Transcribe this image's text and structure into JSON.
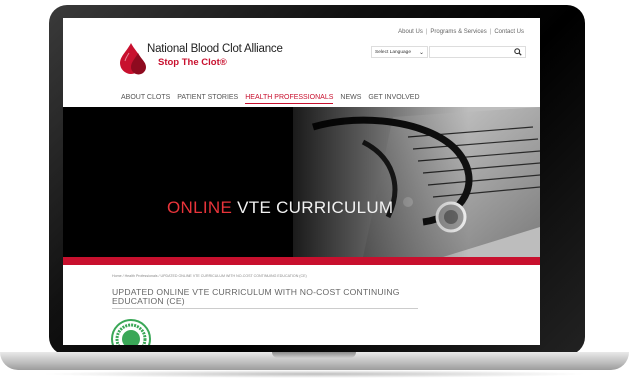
{
  "header": {
    "top_links": [
      "About Us",
      "Programs & Services",
      "Contact Us"
    ],
    "logo_name": "National Blood Clot Alliance",
    "logo_tagline": "Stop The Clot®",
    "language_select": "Select Language",
    "search_placeholder": ""
  },
  "nav": {
    "items": [
      "ABOUT CLOTS",
      "PATIENT STORIES",
      "HEALTH PROFESSIONALS",
      "NEWS",
      "GET INVOLVED"
    ],
    "active_index": 2
  },
  "hero": {
    "title_highlight": "ONLINE",
    "title_rest": "VTE CURRICULUM"
  },
  "content": {
    "breadcrumb": "Home / Health Professionals / UPDATED ONLINE VTE CURRICULUM WITH NO-COST CONTINUING EDUCATION (CE)",
    "page_title": "UPDATED ONLINE VTE CURRICULUM WITH NO-COST CONTINUING EDUCATION (CE)"
  },
  "colors": {
    "brand_red": "#c8102e",
    "hero_red": "#e8343a",
    "badge_green": "#3aa757"
  }
}
